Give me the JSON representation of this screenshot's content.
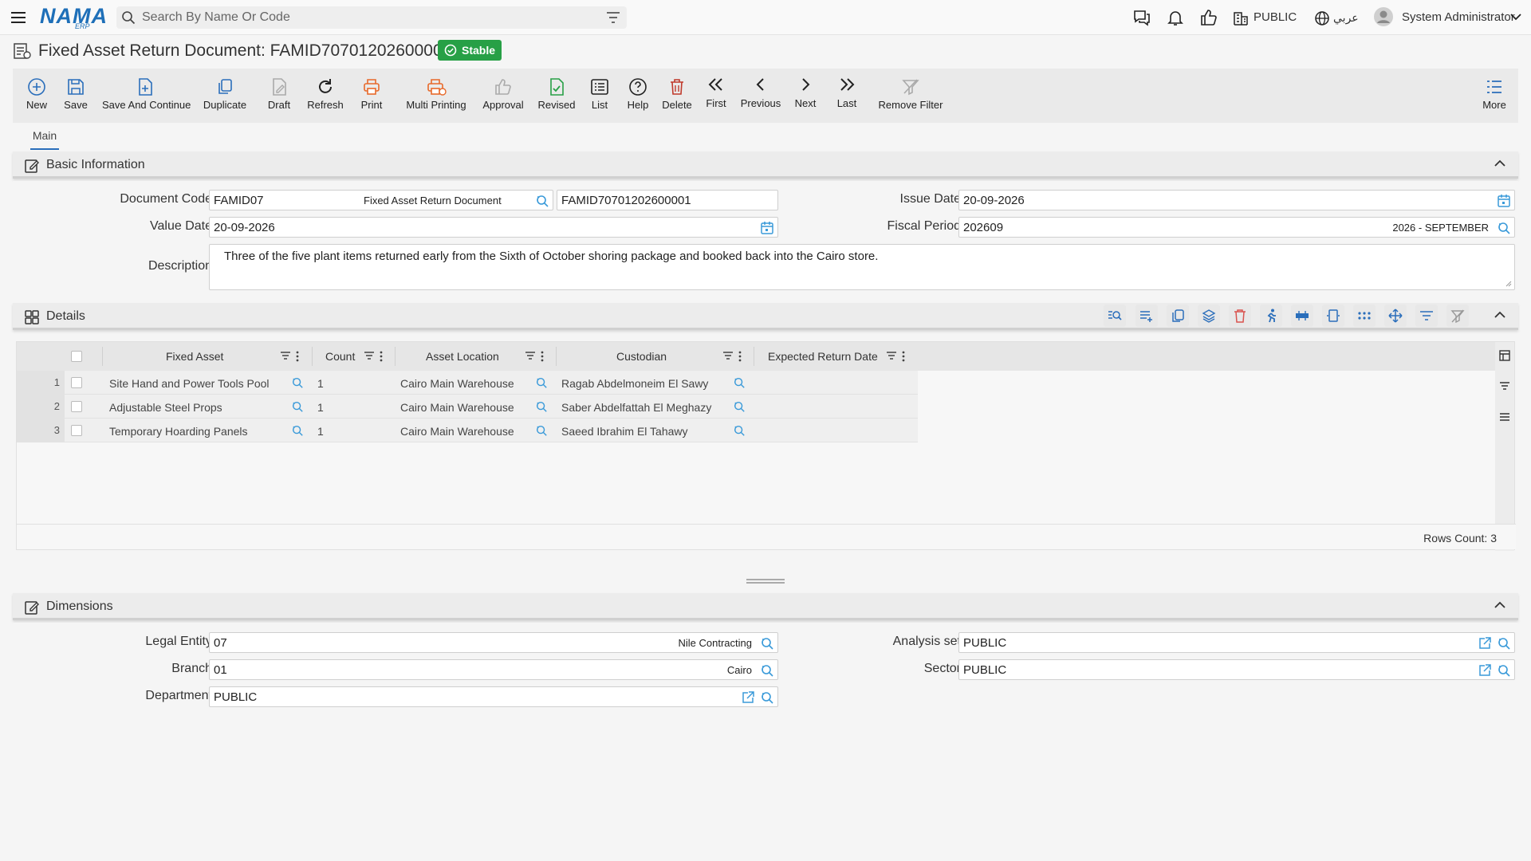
{
  "topbar": {
    "logo_main": "NAMA",
    "logo_sub": "ERP",
    "search_placeholder": "Search By Name Or Code",
    "public_label": "PUBLIC",
    "lang_label": "عربي",
    "user_name": "System Administrator"
  },
  "document": {
    "title": "Fixed Asset Return Document: FAMID70701202600001",
    "status": "Stable"
  },
  "toolbar": {
    "new": "New",
    "save": "Save",
    "save_continue": "Save And Continue",
    "duplicate": "Duplicate",
    "draft": "Draft",
    "refresh": "Refresh",
    "print": "Print",
    "multi_printing": "Multi Printing",
    "approval": "Approval",
    "revised": "Revised",
    "list": "List",
    "help": "Help",
    "delete": "Delete",
    "first": "First",
    "previous": "Previous",
    "next": "Next",
    "last": "Last",
    "remove_filter": "Remove Filter",
    "more": "More"
  },
  "tabs": {
    "main": "Main"
  },
  "basic": {
    "header": "Basic Information",
    "document_code_label": "Document Code",
    "document_code": "FAMID07",
    "document_code_name": "Fixed Asset Return Document",
    "document_number": "FAMID70701202600001",
    "issue_date_label": "Issue Date",
    "issue_date": "20-09-2026",
    "value_date_label": "Value Date",
    "value_date": "20-09-2026",
    "fiscal_period_label": "Fiscal Period",
    "fiscal_period": "202609",
    "fiscal_period_name": "2026 - SEPTEMBER",
    "description_label": "Description",
    "description": "Three of the five plant items returned early from the Sixth of October shoring package and booked back into the Cairo store."
  },
  "details": {
    "header": "Details",
    "columns": {
      "fixed_asset": "Fixed Asset",
      "count": "Count",
      "asset_location": "Asset Location",
      "custodian": "Custodian",
      "expected_return_date": "Expected Return Date"
    },
    "rows": [
      {
        "num": "1",
        "fixed_asset": "Site Hand and Power Tools Pool",
        "count": "1",
        "asset_location": "Cairo Main Warehouse",
        "custodian": "Ragab Abdelmoneim El Sawy",
        "expected_return_date": ""
      },
      {
        "num": "2",
        "fixed_asset": "Adjustable Steel Props",
        "count": "1",
        "asset_location": "Cairo Main Warehouse",
        "custodian": "Saber Abdelfattah El Meghazy",
        "expected_return_date": ""
      },
      {
        "num": "3",
        "fixed_asset": "Temporary Hoarding Panels",
        "count": "1",
        "asset_location": "Cairo Main Warehouse",
        "custodian": "Saeed Ibrahim El Tahawy",
        "expected_return_date": ""
      }
    ],
    "rows_count": "Rows Count: 3"
  },
  "dimensions": {
    "header": "Dimensions",
    "legal_entity_label": "Legal Entity",
    "legal_entity": "07",
    "legal_entity_name": "Nile Contracting",
    "analysis_set_label": "Analysis set",
    "analysis_set": "PUBLIC",
    "branch_label": "Branch",
    "branch": "01",
    "branch_name": "Cairo",
    "sector_label": "Sector",
    "sector": "PUBLIC",
    "department_label": "Department",
    "department": "PUBLIC"
  },
  "colors": {
    "accent": "#2a6ebb",
    "stable": "#27a046",
    "danger": "#d9534f",
    "print": "#e8692a",
    "lookup": "#3a9ad9"
  }
}
